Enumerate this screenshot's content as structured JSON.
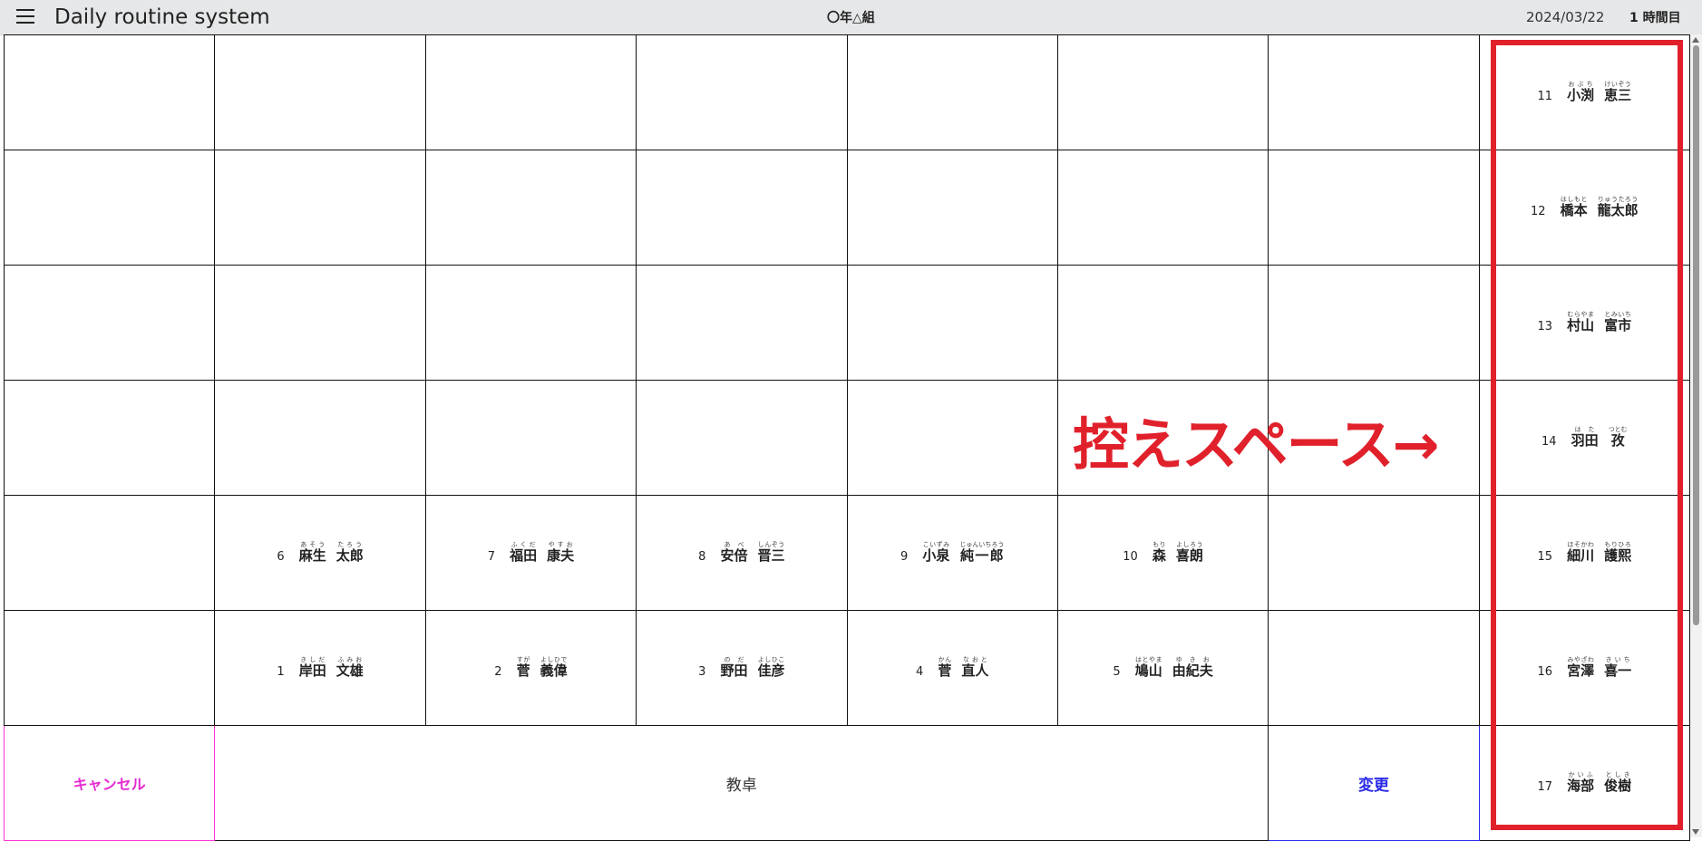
{
  "header": {
    "title": "Daily routine system",
    "class_name": "〇年△組",
    "date": "2024/03/22",
    "period": "1 時間目"
  },
  "seats": {
    "s1": {
      "num": "1",
      "last": "岸田",
      "last_r": "きしだ",
      "first": "文雄",
      "first_r": "ふみお"
    },
    "s2": {
      "num": "2",
      "last": "菅",
      "last_r": "すが",
      "first": "義偉",
      "first_r": "よしひで"
    },
    "s3": {
      "num": "3",
      "last": "野田",
      "last_r": "のだ",
      "first": "佳彦",
      "first_r": "よしひこ"
    },
    "s4": {
      "num": "4",
      "last": "菅",
      "last_r": "かん",
      "first": "直人",
      "first_r": "なおと"
    },
    "s5": {
      "num": "5",
      "last": "鳩山",
      "last_r": "はとやま",
      "first": "由紀夫",
      "first_r": "ゆきお"
    },
    "s6": {
      "num": "6",
      "last": "麻生",
      "last_r": "あそう",
      "first": "太郎",
      "first_r": "たろう"
    },
    "s7": {
      "num": "7",
      "last": "福田",
      "last_r": "ふくだ",
      "first": "康夫",
      "first_r": "やすお"
    },
    "s8": {
      "num": "8",
      "last": "安倍",
      "last_r": "あべ",
      "first": "晋三",
      "first_r": "しんぞう"
    },
    "s9": {
      "num": "9",
      "last": "小泉",
      "last_r": "こいずみ",
      "first": "純一郎",
      "first_r": "じゅんいちろう"
    },
    "s10": {
      "num": "10",
      "last": "森",
      "last_r": "もり",
      "first": "喜朗",
      "first_r": "よしろう"
    },
    "s11": {
      "num": "11",
      "last": "小渕",
      "last_r": "おぶち",
      "first": "恵三",
      "first_r": "けいぞう"
    },
    "s12": {
      "num": "12",
      "last": "橋本",
      "last_r": "はしもと",
      "first": "龍太郎",
      "first_r": "りゅうたろう"
    },
    "s13": {
      "num": "13",
      "last": "村山",
      "last_r": "むらやま",
      "first": "富市",
      "first_r": "とみいち"
    },
    "s14": {
      "num": "14",
      "last": "羽田",
      "last_r": "はた",
      "first": "孜",
      "first_r": "つとむ"
    },
    "s15": {
      "num": "15",
      "last": "細川",
      "last_r": "ほそかわ",
      "first": "護熙",
      "first_r": "もりひろ"
    },
    "s16": {
      "num": "16",
      "last": "宮澤",
      "last_r": "みやざわ",
      "first": "喜一",
      "first_r": "きいち"
    },
    "s17": {
      "num": "17",
      "last": "海部",
      "last_r": "かいふ",
      "first": "俊樹",
      "first_r": "としき"
    }
  },
  "buttons": {
    "cancel": "キャンセル",
    "change": "変更"
  },
  "teacher_desk": "教卓",
  "annotation": "控えスペース→",
  "colors": {
    "cancel": "#e62ad2",
    "change": "#2a2ae8",
    "annotation": "#e0212b",
    "header_bg": "#e6e7e8"
  }
}
